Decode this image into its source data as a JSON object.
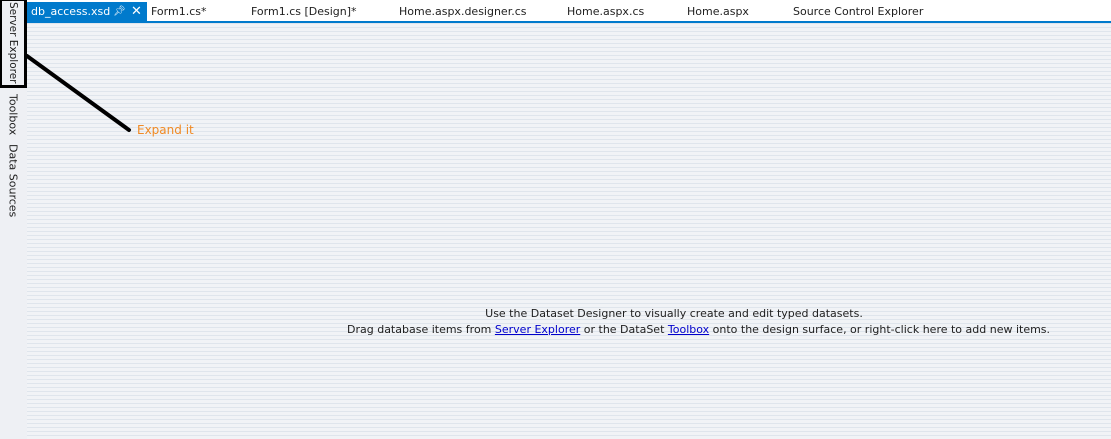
{
  "side_tabs": {
    "server_explorer": "Server Explorer",
    "toolbox": "Toolbox",
    "data_sources": "Data Sources"
  },
  "tabs": [
    {
      "label": "db_access.xsd",
      "active": true
    },
    {
      "label": "Form1.cs*"
    },
    {
      "label": "Form1.cs [Design]*"
    },
    {
      "label": "Home.aspx.designer.cs"
    },
    {
      "label": "Home.aspx.cs"
    },
    {
      "label": "Home.aspx"
    },
    {
      "label": "Source Control Explorer"
    }
  ],
  "active_tab_icons": {
    "pin": "pin-icon",
    "close": "close-icon"
  },
  "designer": {
    "line1": "Use the Dataset Designer to visually create and edit typed datasets.",
    "line2_before": "Drag database items from ",
    "server_explorer_link": "Server Explorer",
    "line2_middle": " or the DataSet ",
    "toolbox_link": "Toolbox",
    "line2_after": " onto the design surface, or right-click here to add new items."
  },
  "annotation": {
    "text": "Expand it",
    "color": "#f08a24"
  },
  "colors": {
    "accent": "#007acc",
    "link": "#0000cc"
  }
}
